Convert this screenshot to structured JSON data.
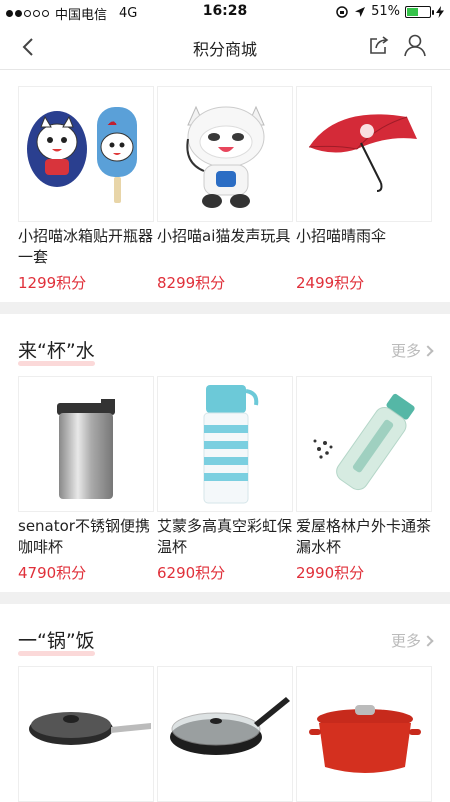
{
  "status": {
    "carrier": "中国电信",
    "network": "4G",
    "time": "16:28",
    "battery": "51%",
    "battery_level": 0.51
  },
  "nav": {
    "title": "积分商城"
  },
  "more_label": "更多",
  "sections": [
    {
      "items": [
        {
          "name": "小招喵冰箱贴开瓶器一套",
          "price": "1299积分"
        },
        {
          "name": "小招喵ai猫发声玩具",
          "price": "8299积分"
        },
        {
          "name": "小招喵晴雨伞",
          "price": "2499积分"
        }
      ]
    },
    {
      "title": "来“杯”水",
      "items": [
        {
          "name": "senator不锈钢便携咖啡杯",
          "price": "4790积分"
        },
        {
          "name": "艾蒙多高真空彩虹保温杯",
          "price": "6290积分"
        },
        {
          "name": "爱屋格林户外卡通茶漏水杯",
          "price": "2990积分"
        }
      ]
    },
    {
      "title": "一“锅”饭",
      "items": [
        {
          "name": "",
          "price": ""
        },
        {
          "name": "",
          "price": ""
        },
        {
          "name": "",
          "price": ""
        }
      ]
    }
  ],
  "colors": {
    "price": "#e0303a",
    "accent_underline": "#fbd5d5",
    "battery": "#35c34a"
  }
}
